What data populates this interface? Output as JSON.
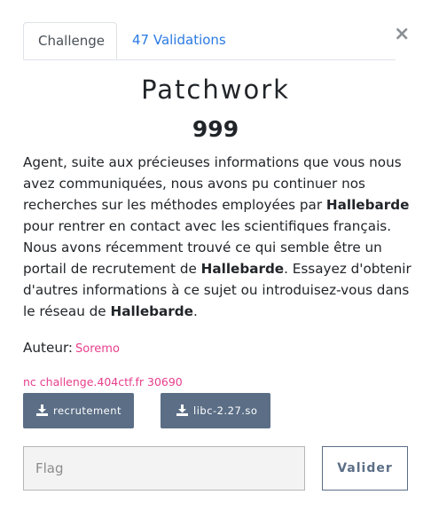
{
  "modal": {
    "close_symbol": "×"
  },
  "tabs": [
    {
      "label": "Challenge",
      "active": true
    },
    {
      "label": "47 Validations",
      "active": false
    }
  ],
  "challenge": {
    "title": "Patchwork",
    "points": "999",
    "description": [
      {
        "text": "Agent, suite aux précieuses informations que vous nous avez communiquées, nous avons pu continuer nos recherches sur les méthodes employées par ",
        "bold": false
      },
      {
        "text": "Hallebarde",
        "bold": true
      },
      {
        "text": " pour rentrer en contact avec les scientifiques français. Nous avons récemment trouvé ce qui semble être un portail de recrutement de ",
        "bold": false
      },
      {
        "text": "Hallebarde",
        "bold": true
      },
      {
        "text": ". Essayez d'obtenir d'autres informations à ce sujet ou introduisez-vous dans le réseau de ",
        "bold": false
      },
      {
        "text": "Hallebarde",
        "bold": true
      },
      {
        "text": ".",
        "bold": false
      }
    ],
    "author_label": "Auteur:",
    "author_name": "Soremo",
    "connection": "nc challenge.404ctf.fr 30690",
    "files": [
      {
        "label": "recrutement",
        "icon": "download-icon"
      },
      {
        "label": "libc-2.27.so",
        "icon": "download-icon"
      }
    ]
  },
  "form": {
    "flag_placeholder": "Flag",
    "flag_value": "",
    "submit_label": "Valider"
  },
  "colors": {
    "link": "#2a7ae2",
    "accent_pink": "#e83e8c",
    "button": "#5b6e86"
  }
}
